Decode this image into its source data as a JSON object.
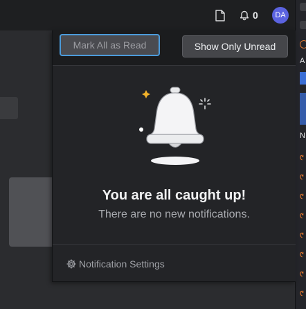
{
  "topbar": {
    "notification_count": "0",
    "avatar_initials": "DA"
  },
  "panel": {
    "mark_all_label": "Mark All as Read",
    "show_unread_label": "Show Only Unread",
    "empty_title": "You are all caught up!",
    "empty_subtitle": "There are no new notifications.",
    "settings_label": "Notification Settings"
  },
  "right_panel": {
    "label_a": "A",
    "label_n": "N"
  },
  "colors": {
    "accent_focus": "#4b9bdb",
    "avatar": "#5b63e0",
    "sparkle": "#f2b22a"
  }
}
